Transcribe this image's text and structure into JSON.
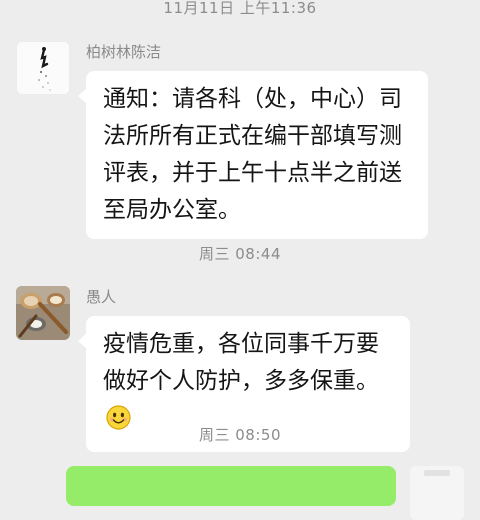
{
  "timestamps": {
    "top": "11月11日 上午11:36",
    "middle": "周三 08:44",
    "bottom": "周三 08:50"
  },
  "messages": [
    {
      "sender": "柏树林陈洁",
      "text": "通知：请各科（处，中心）司法所所有正式在编干部填写测评表，并于上午十点半之前送至局办公室。",
      "avatar_icon": "ink-figure-avatar-icon"
    },
    {
      "sender": "愚人",
      "text": "疫情危重，各位同事千万要做好个人防护，多多保重。",
      "emoji": "smiling-face-icon",
      "avatar_icon": "spoons-avatar-icon"
    }
  ],
  "colors": {
    "background": "#ededed",
    "bubble_incoming": "#ffffff",
    "bubble_outgoing": "#95ec69",
    "timestamp": "#8c8c8c",
    "sender_name": "#8a8a8a"
  }
}
